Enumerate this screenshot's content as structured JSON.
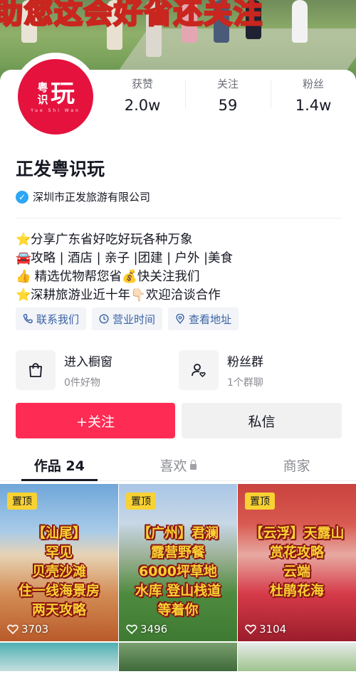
{
  "banner": {
    "overlay_text": "助您这会好省还关注"
  },
  "profile": {
    "avatar": {
      "small_1": "粤",
      "small_2": "识",
      "big": "玩",
      "sub": "Yue Shi Wan"
    },
    "name": "正发粤识玩",
    "verification": "深圳市正发旅游有限公司"
  },
  "stats": [
    {
      "label": "获赞",
      "value": "2.0w"
    },
    {
      "label": "关注",
      "value": "59"
    },
    {
      "label": "粉丝",
      "value": "1.4w"
    }
  ],
  "bio": [
    {
      "emoji": "⭐",
      "text": "分享广东省好吃好玩各种万象"
    },
    {
      "emoji": "🚘",
      "text": "攻略 | 酒店 | 亲子 |团建 | 户外 |美食"
    },
    {
      "emoji": "👍",
      "text": " 精选优物帮您省💰快关注我们"
    },
    {
      "emoji": "⭐",
      "text": "深耕旅游业近十年👇🏻欢迎洽谈合作"
    }
  ],
  "chips": [
    {
      "label": "联系我们",
      "icon": "phone-icon"
    },
    {
      "label": "营业时间",
      "icon": "clock-icon"
    },
    {
      "label": "查看地址",
      "icon": "location-icon"
    }
  ],
  "entries": [
    {
      "title": "进入橱窗",
      "sub": "0件好物",
      "icon": "shopping-bag-icon"
    },
    {
      "title": "粉丝群",
      "sub": "1个群聊",
      "icon": "fan-group-icon"
    }
  ],
  "actions": {
    "follow": "+关注",
    "message": "私信"
  },
  "tabs": [
    {
      "label": "作品 24"
    },
    {
      "label": "喜欢"
    },
    {
      "label": "商家"
    }
  ],
  "videos": [
    {
      "pin": "置顶",
      "caption": "【汕尾】\n罕见\n贝壳沙滩\n住一线海景房\n两天攻略",
      "likes": "3703"
    },
    {
      "pin": "置顶",
      "caption": "【广州】君澜\n露营野餐\n6000坪草地\n水库 登山栈道\n等着你",
      "likes": "3496"
    },
    {
      "pin": "置顶",
      "caption": "【云浮】天露山\n赏花攻略\n云端\n杜鹃花海",
      "likes": "3104"
    }
  ],
  "colors": {
    "accent": "#fe2c55",
    "pin": "#f8d233",
    "chip_text": "#3a63a8",
    "verified": "#2da7f4"
  }
}
